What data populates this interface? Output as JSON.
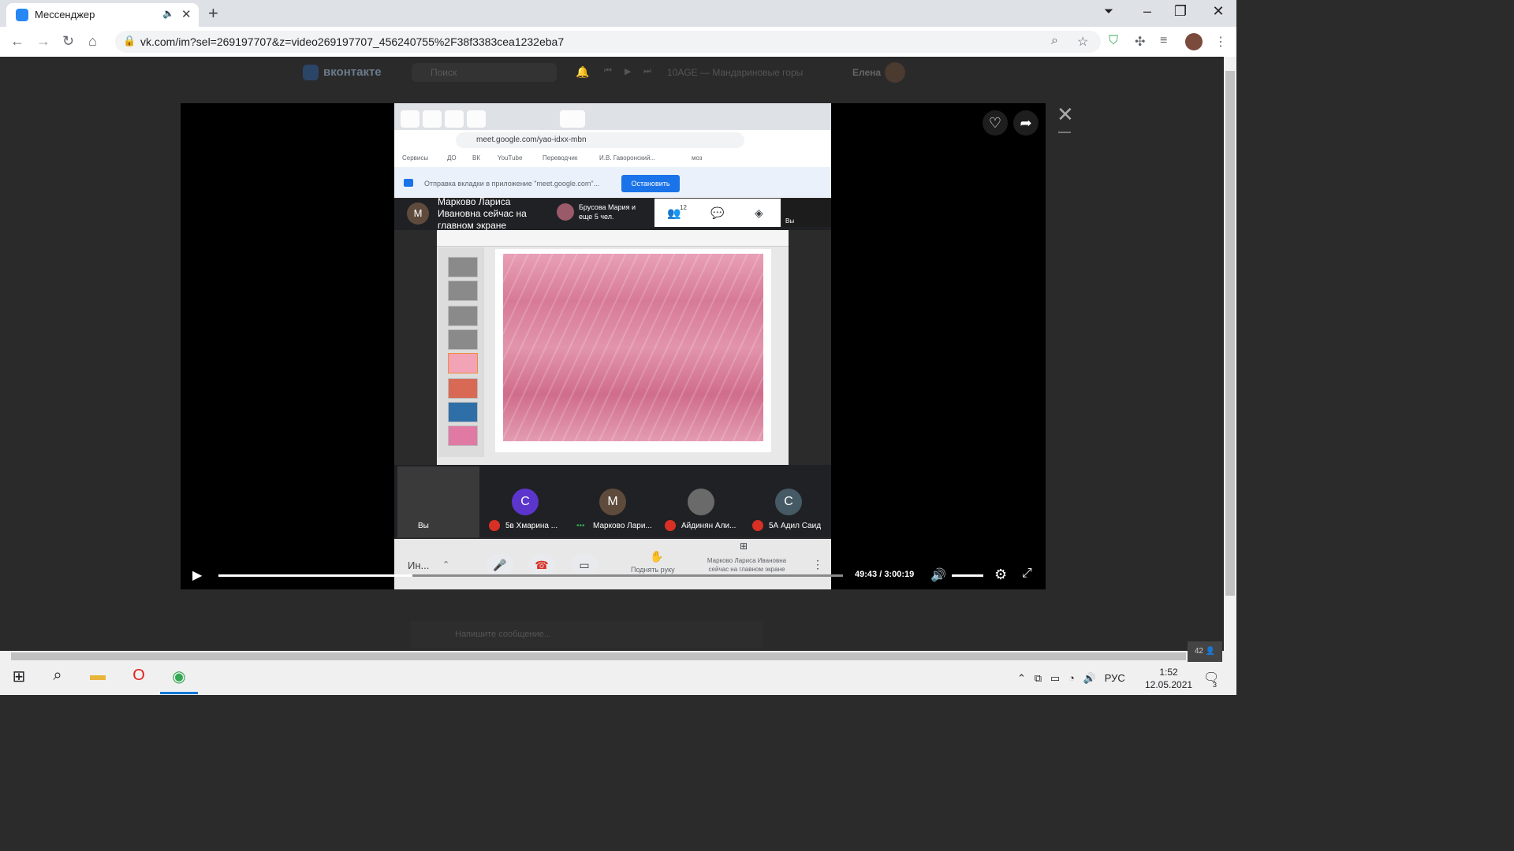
{
  "browser": {
    "tab_title": "Мессенджер",
    "url": "vk.com/im?sel=269197707&z=video269197707_456240755%2F38f3383cea1232eba7"
  },
  "vk": {
    "logo_text": "вконтакте",
    "search_placeholder": "Поиск",
    "now_playing": "10AGE — Мандариновые горы",
    "user_name": "Елена",
    "message_placeholder": "Напишите сообщение...",
    "viewers_count": "42"
  },
  "video": {
    "inner_url": "meet.google.com/yao-idxx-mbn",
    "bookmarks": [
      "Сервисы",
      "ДО",
      "ВК",
      "YouTube",
      "Переводчик",
      "И.В. Гаворонский...",
      "моз"
    ],
    "share_text": "Отправка вкладки в приложение \"meet.google.com\"...",
    "stop_button": "Остановить",
    "meet_avatar_letter": "M",
    "presenter_text": "Марково Лариса Ивановна сейчас на главном экране",
    "pill_text": "Брусова Мария и еще 5 чел.",
    "participants_count": "12",
    "self_label": "Вы",
    "participants": [
      {
        "letter": "C",
        "name": "5в Хмарина ...",
        "color": "#5c35cc",
        "muted": true
      },
      {
        "letter": "M",
        "name": "Марково Лари...",
        "color": "#5f4b3c",
        "muted": false
      },
      {
        "letter": "",
        "name": "Айдинян Али...",
        "color": "#6a6a6a",
        "muted": true
      },
      {
        "letter": "C",
        "name": "5А Адил Саид",
        "color": "#455a64",
        "muted": true
      }
    ],
    "meeting_info_label": "Ин...",
    "raise_hand_label": "Поднять руку",
    "presenting_label": "Марково Лариса Ивановна сейчас на главном экране",
    "time_current": "49:43",
    "time_total": "3:00:19",
    "progress_fraction": 0.31
  },
  "taskbar": {
    "language": "РУС",
    "time": "1:52",
    "date": "12.05.2021",
    "notification_count": "3"
  }
}
